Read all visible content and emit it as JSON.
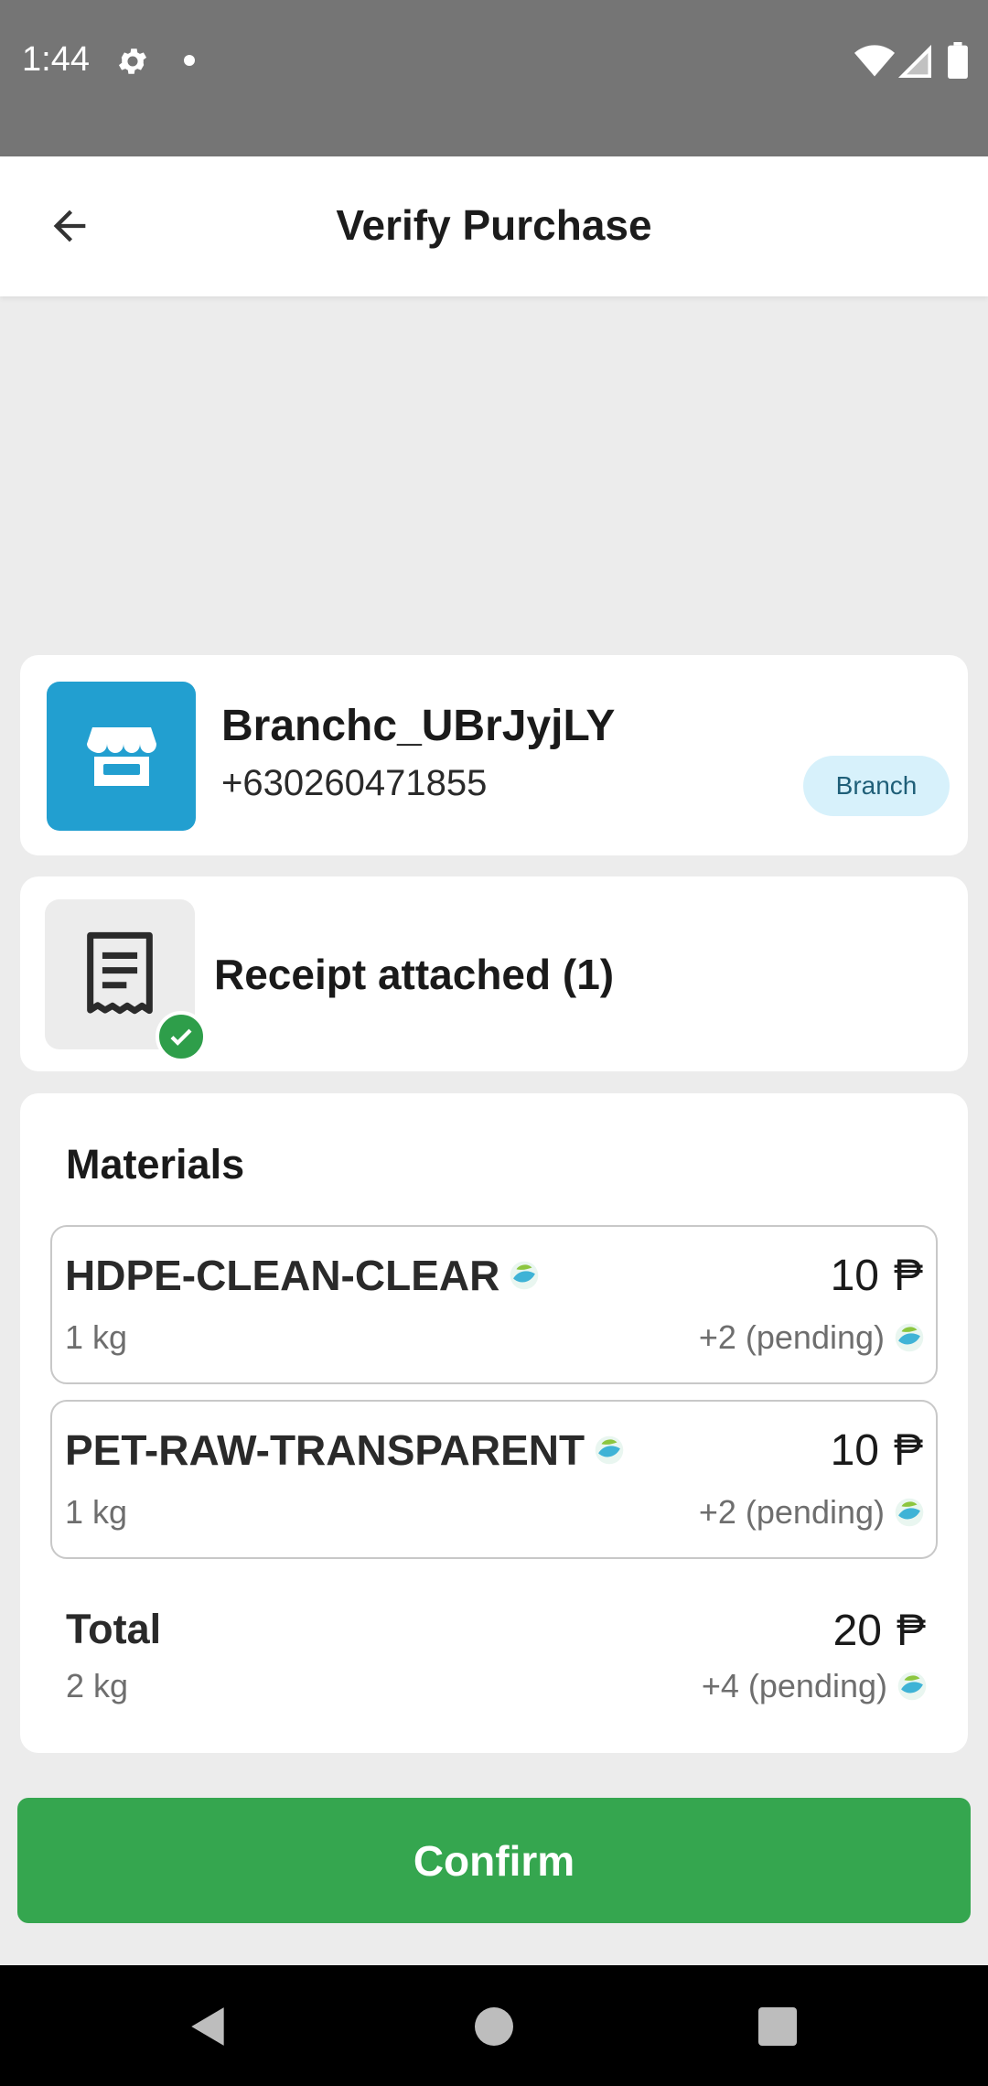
{
  "status_bar": {
    "time": "1:44"
  },
  "header": {
    "title": "Verify Purchase"
  },
  "branch": {
    "name": "Branchc_UBrJyjLY",
    "phone": "+630260471855",
    "badge": "Branch"
  },
  "receipt": {
    "label": "Receipt attached (1)"
  },
  "materials": {
    "title": "Materials",
    "items": [
      {
        "name": "HDPE-CLEAN-CLEAR",
        "qty": "1 kg",
        "price": "10",
        "currency": "₱",
        "pending": "+2 (pending)"
      },
      {
        "name": "PET-RAW-TRANSPARENT",
        "qty": "1 kg",
        "price": "10",
        "currency": "₱",
        "pending": "+2 (pending)"
      }
    ],
    "total": {
      "label": "Total",
      "qty": "2 kg",
      "price": "20",
      "currency": "₱",
      "pending": "+4 (pending)"
    }
  },
  "actions": {
    "confirm_label": "Confirm"
  },
  "colors": {
    "accent_green": "#35a64f",
    "branch_blue": "#229fd0",
    "badge_bg": "#d7f1fb"
  },
  "icons": {
    "back": "arrow-left-icon",
    "branch": "storefront-icon",
    "receipt": "receipt-icon",
    "check": "check-circle-icon",
    "coin": "eco-coin-icon"
  }
}
